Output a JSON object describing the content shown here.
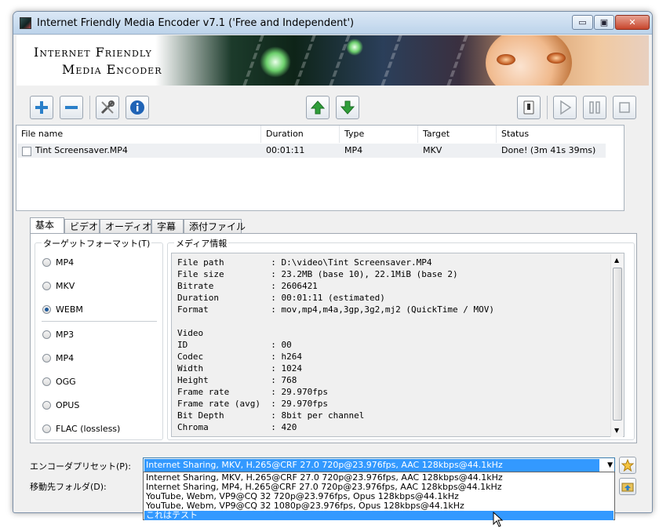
{
  "window": {
    "title": "Internet Friendly Media Encoder v7.1 ('Free and Independent')",
    "min_glyph": "▭",
    "max_glyph": "▣",
    "close_glyph": "✕"
  },
  "banner": {
    "line1": "Internet Friendly",
    "line2": "Media Encoder"
  },
  "toolbar": {
    "add_icon": "plus-icon",
    "remove_icon": "minus-icon",
    "settings_icon": "tools-icon",
    "info_icon": "info-icon",
    "move_up_icon": "arrow-up-icon",
    "move_down_icon": "arrow-down-icon",
    "shutdown_icon": "power-switch-icon",
    "play_icon": "play-icon",
    "pause_icon": "pause-icon",
    "stop_icon": "stop-icon"
  },
  "file_list": {
    "columns": [
      "File name",
      "Duration",
      "Type",
      "Target",
      "Status"
    ],
    "rows": [
      {
        "file_name": "Tint Screensaver.MP4",
        "duration": "00:01:11",
        "type": "MP4",
        "target": "MKV",
        "status": "Done! (3m 41s 39ms)"
      }
    ]
  },
  "tabs": [
    "基本",
    "ビデオ",
    "オーディオ",
    "字幕",
    "添付ファイル"
  ],
  "target_format": {
    "title": "ターゲットフォーマット(T)",
    "video_options": [
      "MP4",
      "MKV",
      "WEBM"
    ],
    "audio_options": [
      "MP3",
      "MP4",
      "OGG",
      "OPUS",
      "FLAC (lossless)"
    ],
    "selected": "WEBM"
  },
  "media_info": {
    "title": "メディア情報",
    "lines": [
      "File path         : D:\\video\\Tint Screensaver.MP4",
      "File size         : 23.2MB (base 10), 22.1MiB (base 2)",
      "Bitrate           : 2606421",
      "Duration          : 00:01:11 (estimated)",
      "Format            : mov,mp4,m4a,3gp,3g2,mj2 (QuickTime / MOV)",
      "",
      "Video",
      "ID                : 00",
      "Codec             : h264",
      "Width             : 1024",
      "Height            : 768",
      "Frame rate        : 29.970fps",
      "Frame rate (avg)  : 29.970fps",
      "Bit Depth         : 8bit per channel",
      "Chroma            : 420"
    ]
  },
  "preset": {
    "label": "エンコーダプリセット(P):",
    "selected": "Internet Sharing, MKV, H.265@CRF 27.0 720p@23.976fps, AAC 128kbps@44.1kHz",
    "options": [
      "Internet Sharing, MKV, H.265@CRF 27.0 720p@23.976fps, AAC 128kbps@44.1kHz",
      "Internet Sharing, MP4, H.265@CRF 27.0 720p@23.976fps, AAC 128kbps@44.1kHz",
      "YouTube, Webm, VP9@CQ 32 720p@23.976fps, Opus 128kbps@44.1kHz",
      "YouTube, Webm, VP9@CQ 32 1080p@23.976fps, Opus 128kbps@44.1kHz",
      "これはテスト"
    ],
    "highlighted_index": 4,
    "favorite_icon": "star-icon"
  },
  "destination": {
    "label": "移動先フォルダ(D):",
    "browse_icon": "folder-arrow-icon"
  },
  "colors": {
    "selection": "#3399ff",
    "add_remove": "#2a7fc9",
    "move_arrows": "#2f9e3a"
  }
}
